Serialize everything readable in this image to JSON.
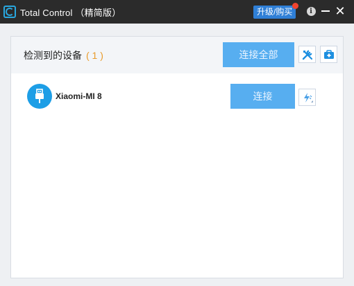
{
  "window": {
    "title": "Total Control （精简版）",
    "upgrade_label": "升级/购买",
    "info_glyph": "i",
    "close_glyph": "✕"
  },
  "header": {
    "title": "检测到的设备",
    "count": "( 1 )",
    "connect_all_label": "连接全部"
  },
  "devices": [
    {
      "name": "Xiaomi-MI 8",
      "connect_label": "连接",
      "icon": "usb-icon"
    }
  ],
  "colors": {
    "titlebar": "#2b2b2b",
    "upgrade": "#2f7fd6",
    "accent_button": "#57aef0",
    "device_avatar": "#1d9ee6",
    "count": "#e99b2a"
  },
  "icons": [
    "app-logo-icon",
    "info-icon",
    "minimize-icon",
    "close-icon",
    "tools-icon",
    "toolbox-icon",
    "usb-icon",
    "flash-icon"
  ]
}
